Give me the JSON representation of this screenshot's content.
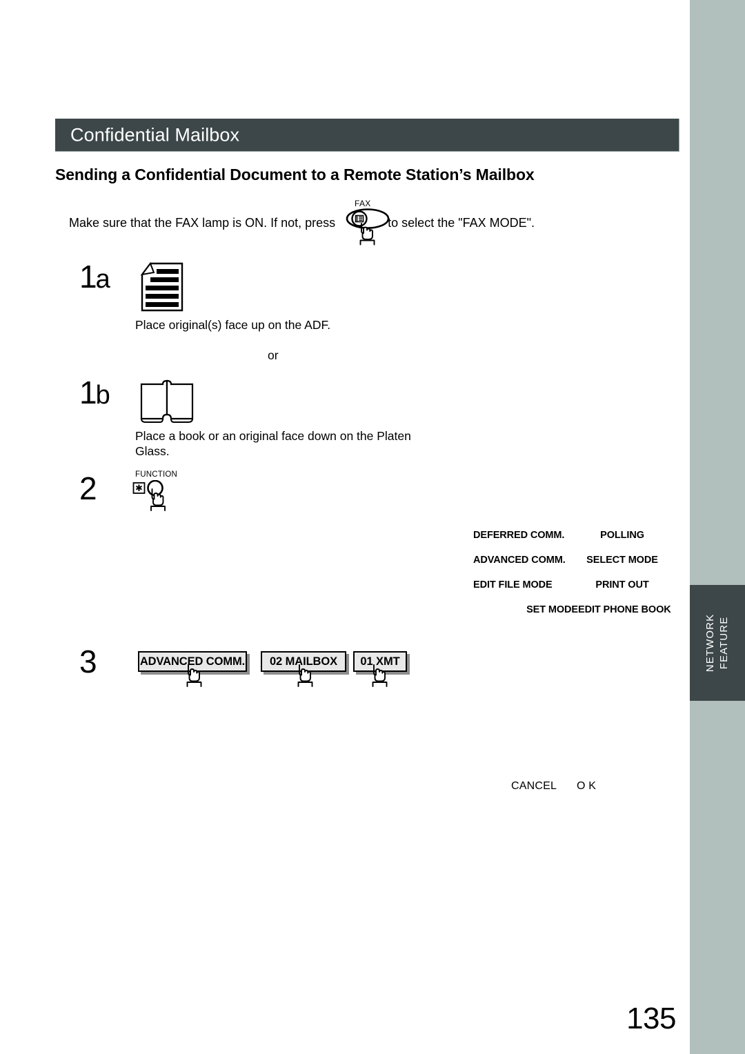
{
  "page": {
    "chapter_band_title": "Confidential Mailbox",
    "section_title": "Sending a Confidential Document to a Remote Station’s Mailbox",
    "folio": "135",
    "band_color": "#3d4749",
    "edge_strip_color": "#b2c0bd"
  },
  "side_tab": {
    "line1": "NETWORK",
    "line2": "FEATURE"
  },
  "intro": {
    "text_before": "Make sure that the FAX lamp is ON.  If not, press",
    "text_after": "to select the \"FAX MODE\".",
    "fax_button_label": "FAX"
  },
  "steps": [
    {
      "number": "1",
      "letter": "a",
      "icon": "document-page-icon",
      "caption": "Place original(s) face up on the ADF."
    },
    {
      "number": "1",
      "letter": "b",
      "icon": "open-book-icon",
      "caption": "Place a book or an original face down on the Platen Glass."
    },
    {
      "number": "2",
      "letter": "",
      "icon": "function-key-icon",
      "caption": ""
    },
    {
      "number": "3",
      "letter": "",
      "icon": "",
      "caption": ""
    }
  ],
  "or_divider": "or",
  "function_key": {
    "label": "FUNCTION",
    "asterisk_glyph": "✻"
  },
  "menu": {
    "rows": [
      {
        "left": "DEFERRED COMM.",
        "right": "POLLING"
      },
      {
        "left": "ADVANCED COMM.",
        "right": "SELECT MODE"
      },
      {
        "left": "EDIT FILE MODE",
        "right": "PRINT OUT"
      },
      {
        "left": "SET MODE",
        "right": "EDIT PHONE BOOK"
      }
    ]
  },
  "step3_buttons": [
    {
      "label": "ADVANCED COMM."
    },
    {
      "label": "02 MAILBOX"
    },
    {
      "label": "01 XMT"
    }
  ],
  "softkeys": {
    "cancel": "CANCEL",
    "ok": "O K"
  }
}
